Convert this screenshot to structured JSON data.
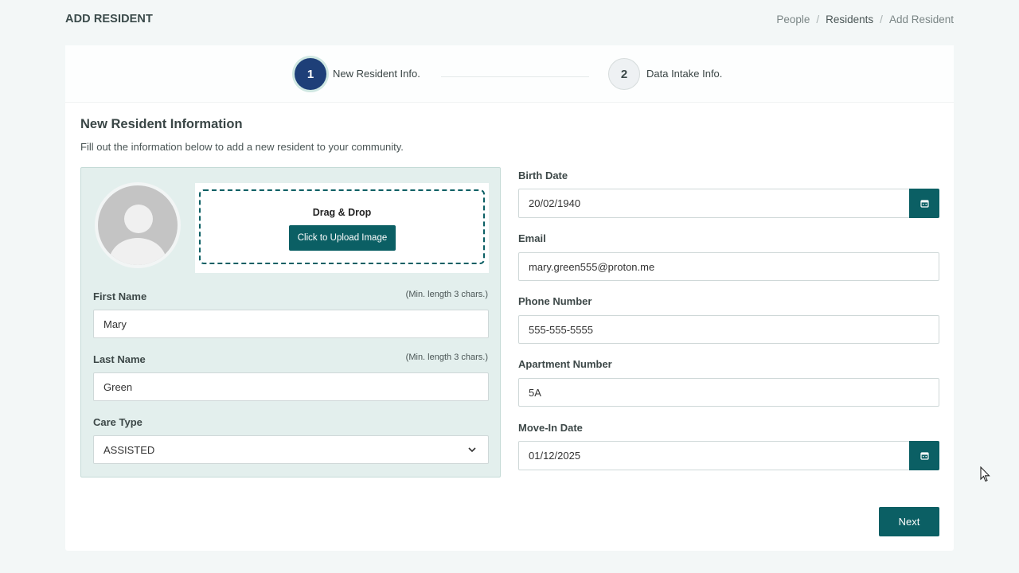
{
  "header": {
    "title": "ADD RESIDENT",
    "breadcrumb": [
      "People",
      "Residents",
      "Add Resident"
    ]
  },
  "stepper": {
    "steps": [
      {
        "number": "1",
        "label": "New Resident Info.",
        "active": true
      },
      {
        "number": "2",
        "label": "Data Intake Info.",
        "active": false
      }
    ]
  },
  "section": {
    "title": "New Resident Information",
    "subtitle": "Fill out the information below to add a new resident to your community."
  },
  "upload": {
    "title": "Drag & Drop",
    "button_label": "Click to Upload Image"
  },
  "form": {
    "first_name": {
      "label": "First Name",
      "hint": "(Min. length 3 chars.)",
      "value": "Mary"
    },
    "last_name": {
      "label": "Last Name",
      "hint": "(Min. length 3 chars.)",
      "value": "Green"
    },
    "care_type": {
      "label": "Care Type",
      "value": "ASSISTED"
    },
    "birth_date": {
      "label": "Birth Date",
      "value": "20/02/1940"
    },
    "email": {
      "label": "Email",
      "value": "mary.green555@proton.me"
    },
    "phone": {
      "label": "Phone Number",
      "value": "555-555-5555"
    },
    "apartment": {
      "label": "Apartment Number",
      "value": "5A"
    },
    "move_in_date": {
      "label": "Move-In Date",
      "value": "01/12/2025"
    }
  },
  "actions": {
    "next_label": "Next"
  },
  "colors": {
    "primary": "#0b5f64",
    "step_active": "#1e3f78",
    "panel_bg": "#e3efed"
  },
  "icons": [
    "calendar-icon",
    "chevron-down-icon",
    "avatar-placeholder-icon",
    "mouse-cursor-icon"
  ]
}
